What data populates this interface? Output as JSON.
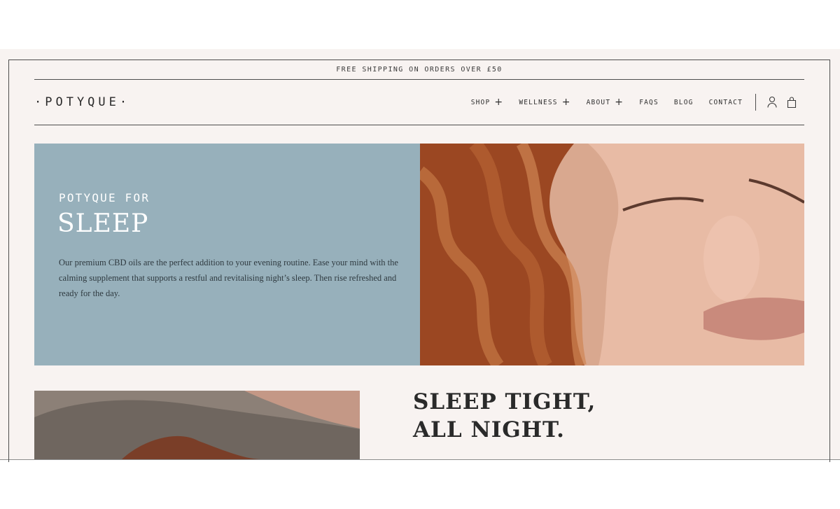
{
  "announcement": "FREE SHIPPING ON ORDERS OVER £50",
  "logo": "·POTYQUE·",
  "nav": {
    "shop": "SHOP",
    "wellness": "WELLNESS",
    "about": "ABOUT",
    "faqs": "FAQS",
    "blog": "BLOG",
    "contact": "CONTACT"
  },
  "icons": {
    "plus": "+",
    "account": "account-icon",
    "bag": "bag-icon"
  },
  "hero": {
    "kicker": "POTYQUE FOR",
    "title": "SLEEP",
    "body": "Our premium CBD oils are the perfect addition to your evening routine. Ease your mind with the calming supplement that supports a restful and revitalising night’s sleep. Then rise refreshed and ready for the day."
  },
  "section": {
    "heading_line1": "SLEEP TIGHT,",
    "heading_line2": "ALL NIGHT."
  },
  "colors": {
    "background": "#f8f3f1",
    "hero_panel": "#97b0bb",
    "text_dark": "#2f2f2f"
  }
}
